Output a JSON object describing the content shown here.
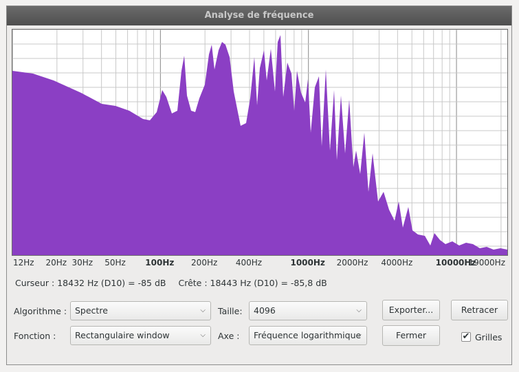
{
  "window": {
    "title": "Analyse de fréquence"
  },
  "plot": {
    "fill_color": "#8b3fc4",
    "grid": true,
    "x_scale": "log",
    "x_range_hz": [
      10,
      22050
    ]
  },
  "x_ticks": [
    {
      "hz": 12,
      "label": "12Hz",
      "major": false
    },
    {
      "hz": 20,
      "label": "20Hz",
      "major": false
    },
    {
      "hz": 30,
      "label": "30Hz",
      "major": false
    },
    {
      "hz": 50,
      "label": "50Hz",
      "major": false
    },
    {
      "hz": 100,
      "label": "100Hz",
      "major": true
    },
    {
      "hz": 200,
      "label": "200Hz",
      "major": false
    },
    {
      "hz": 400,
      "label": "400Hz",
      "major": false
    },
    {
      "hz": 1000,
      "label": "1000Hz",
      "major": true
    },
    {
      "hz": 2000,
      "label": "2000Hz",
      "major": false
    },
    {
      "hz": 4000,
      "label": "4000Hz",
      "major": false
    },
    {
      "hz": 10000,
      "label": "10000Hz",
      "major": true
    },
    {
      "hz": 19000,
      "label": "19000Hz",
      "major": false
    }
  ],
  "status": {
    "cursor": "Curseur : 18432 Hz (D10) = -85 dB",
    "peak": "Crête : 18443 Hz (D10) = -85,8 dB"
  },
  "controls": {
    "algorithm_label": "Algorithme :",
    "algorithm_value": "Spectre",
    "function_label": "Fonction :",
    "function_value": "Rectangulaire window",
    "size_label": "Taille:",
    "size_value": "4096",
    "axis_label": "Axe :",
    "axis_value": "Fréquence logarithmique",
    "export_button": "Exporter...",
    "close_button": "Fermer",
    "replot_button": "Retracer",
    "grids_label": "Grilles",
    "grids_checked": true
  }
}
